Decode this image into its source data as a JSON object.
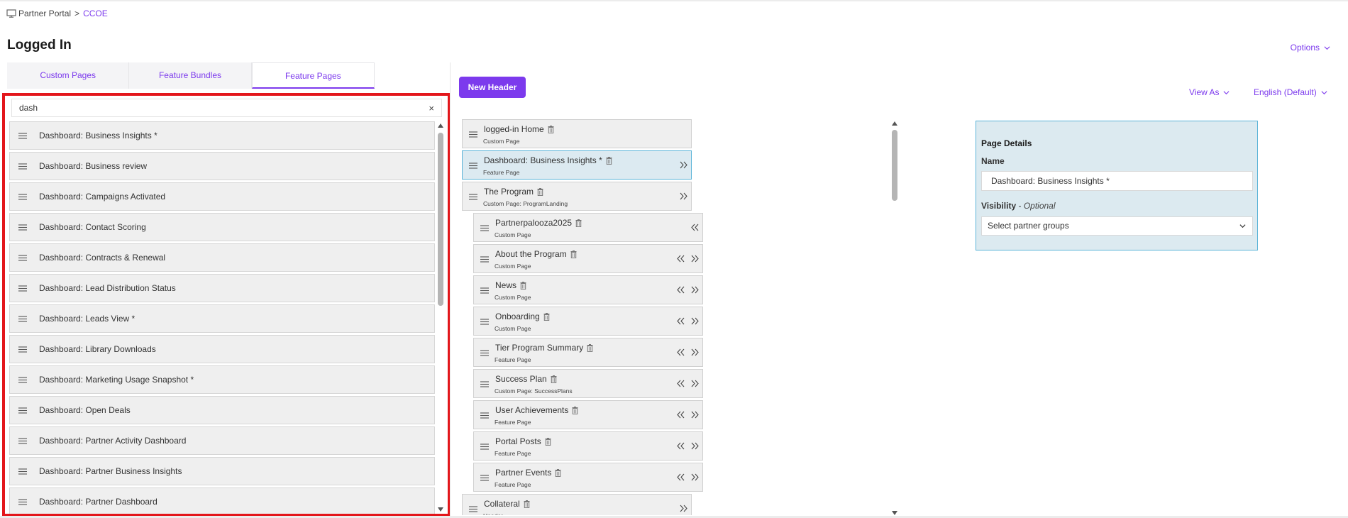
{
  "breadcrumb": {
    "root": "Partner Portal",
    "separator": ">",
    "current": "CCOE"
  },
  "page_title": "Logged In",
  "options_label": "Options",
  "tabs": [
    {
      "label": "Custom Pages",
      "active": false
    },
    {
      "label": "Feature Bundles",
      "active": false
    },
    {
      "label": "Feature Pages",
      "active": true
    }
  ],
  "search": {
    "value": "dash",
    "clear": "×"
  },
  "feature_pages": [
    "Dashboard: Business Insights *",
    "Dashboard: Business review",
    "Dashboard: Campaigns Activated",
    "Dashboard: Contact Scoring",
    "Dashboard: Contracts & Renewal",
    "Dashboard: Lead Distribution Status",
    "Dashboard: Leads View *",
    "Dashboard: Library Downloads",
    "Dashboard: Marketing Usage Snapshot *",
    "Dashboard: Open Deals",
    "Dashboard: Partner Activity Dashboard",
    "Dashboard: Partner Business Insights",
    "Dashboard: Partner Dashboard"
  ],
  "new_header_label": "New Header",
  "view_as_label": "View As",
  "language_label": "English (Default)",
  "tree": [
    {
      "title": "logged-in Home",
      "sub": "Custom Page",
      "level": 0,
      "arrows": []
    },
    {
      "title": "Dashboard: Business Insights *",
      "sub": "Feature Page",
      "level": 0,
      "arrows": [
        "right"
      ],
      "selected": true
    },
    {
      "title": "The Program",
      "sub": "Custom Page: ProgramLanding",
      "level": 0,
      "arrows": [
        "right"
      ]
    },
    {
      "title": "Partnerpalooza2025",
      "sub": "Custom Page",
      "level": 1,
      "arrows": [
        "left"
      ]
    },
    {
      "title": "About the Program",
      "sub": "Custom Page",
      "level": 1,
      "arrows": [
        "left",
        "right"
      ]
    },
    {
      "title": "News",
      "sub": "Custom Page",
      "level": 1,
      "arrows": [
        "left",
        "right"
      ]
    },
    {
      "title": "Onboarding",
      "sub": "Custom Page",
      "level": 1,
      "arrows": [
        "left",
        "right"
      ]
    },
    {
      "title": "Tier Program Summary",
      "sub": "Feature Page",
      "level": 1,
      "arrows": [
        "left",
        "right"
      ]
    },
    {
      "title": "Success Plan",
      "sub": "Custom Page: SuccessPlans",
      "level": 1,
      "arrows": [
        "left",
        "right"
      ]
    },
    {
      "title": "User Achievements",
      "sub": "Feature Page",
      "level": 1,
      "arrows": [
        "left",
        "right"
      ]
    },
    {
      "title": "Portal Posts",
      "sub": "Feature Page",
      "level": 1,
      "arrows": [
        "left",
        "right"
      ]
    },
    {
      "title": "Partner Events",
      "sub": "Feature Page",
      "level": 1,
      "arrows": [
        "left",
        "right"
      ]
    },
    {
      "title": "Collateral",
      "sub": "Header",
      "level": 0,
      "arrows": [
        "right"
      ]
    }
  ],
  "details": {
    "title": "Page Details",
    "name_label": "Name",
    "name_value": "Dashboard: Business Insights *",
    "visibility_label": "Visibility",
    "visibility_separator": " - ",
    "visibility_optional": "Optional",
    "select_placeholder": "Select partner groups"
  },
  "colors": {
    "accent": "#7c3aed",
    "highlight_border": "#e3161b",
    "selected_bg": "#dceaf1",
    "selected_border": "#5bb4d8"
  }
}
